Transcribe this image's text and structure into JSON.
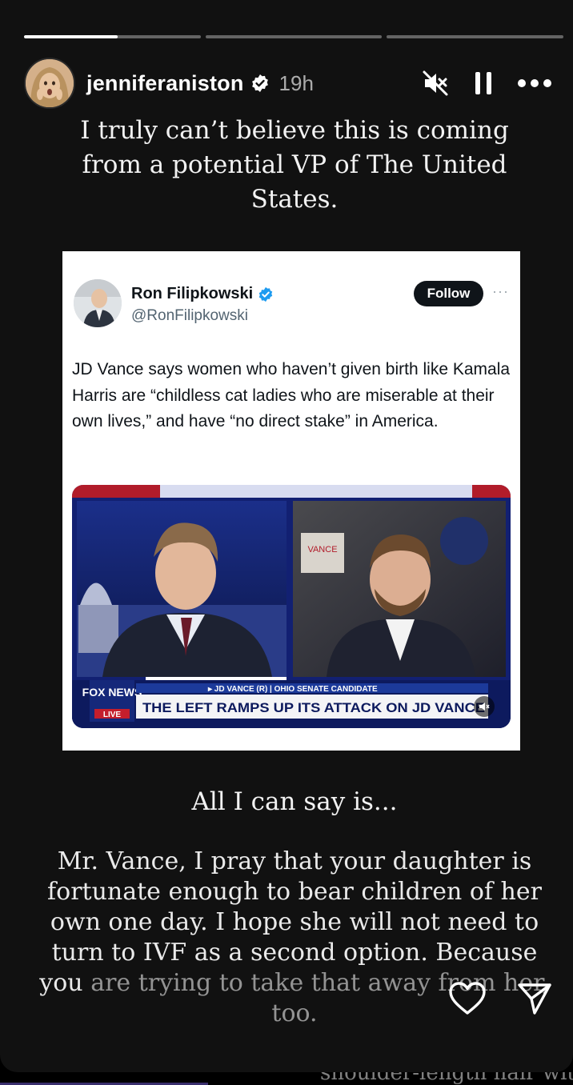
{
  "progress": {
    "segments": 3,
    "active_fraction": 0.53
  },
  "header": {
    "username": "jenniferaniston",
    "time": "19h",
    "verified_color": "#ffffff"
  },
  "caption_top": "I truly can’t believe this is coming from a potential VP of The United States.",
  "tweet": {
    "name": "Ron Filipkowski",
    "handle": "@RonFilipkowski",
    "follow_label": "Follow",
    "more_label": "···",
    "verified_color": "#1d9bf0",
    "text": "JD Vance says women who haven’t given birth like Kamala Harris are “childless cat ladies who are miserable at their own lives,” and have “no direct stake” in America.",
    "video": {
      "network": "FOX NEWS",
      "live": "LIVE",
      "lower_third_top": "▸ JD VANCE (R) | OHIO SENATE CANDIDATE",
      "headline": "THE LEFT RAMPS UP ITS ATTACK ON JD VANCE",
      "sign": "VANCE"
    }
  },
  "caption_mid": "All I can say is...",
  "caption_body_main": "Mr. Vance, I pray that your daughter is fortunate enough to bear children of her own one day. I hope she will not need to turn to IVF as a second option. Because you",
  "caption_body_faded": "are trying to take that away from her, too.",
  "footer": {
    "like_icon": "heart-icon",
    "share_icon": "send-icon"
  },
  "bottom_ghost_text": "shoulder-length hair with"
}
